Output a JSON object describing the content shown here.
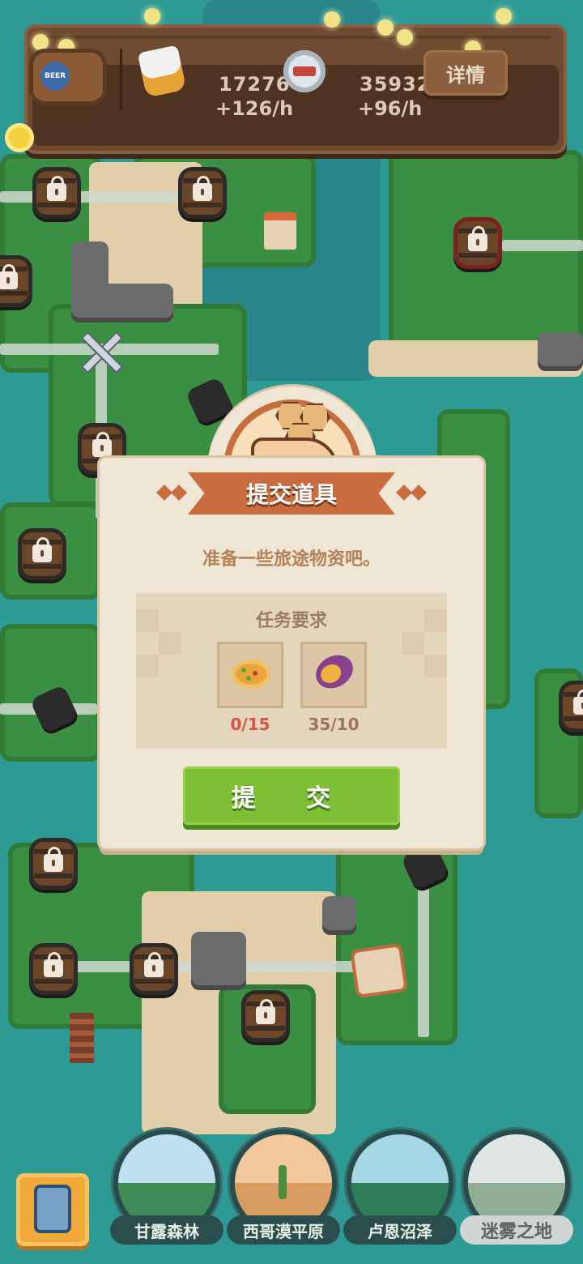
{
  "hud": {
    "detail_label": "详情",
    "barrel_label": "BEER",
    "resources": [
      {
        "name": "cup",
        "value": "17276",
        "rate": "+126/h"
      },
      {
        "name": "bottle-cap",
        "value": "35932",
        "rate": "+96/h"
      }
    ]
  },
  "dialog": {
    "title": "提交道具",
    "subtitle": "准备一些旅途物资吧。",
    "requirements_title": "任务要求",
    "items": [
      {
        "icon": "pizza-icon",
        "progress": "0/15",
        "status_color": "#d9534a"
      },
      {
        "icon": "sweet-potato-icon",
        "progress": "35/10",
        "status_color": "#9a7557"
      }
    ],
    "submit_label": "提 交"
  },
  "bottom_nav": {
    "regions": [
      {
        "name": "甘露森林",
        "locked": false
      },
      {
        "name": "西哥漠平原",
        "locked": false
      },
      {
        "name": "卢恩沼泽",
        "locked": false
      },
      {
        "name": "迷雾之地",
        "locked": true
      }
    ]
  },
  "colors": {
    "water": "#2e9a94",
    "land": "#3b8f43",
    "dialog_bg": "#efe6d5",
    "ribbon": "#c96c3e",
    "submit_button": "#7cbf35",
    "hud_wood": "#6e4a30"
  }
}
